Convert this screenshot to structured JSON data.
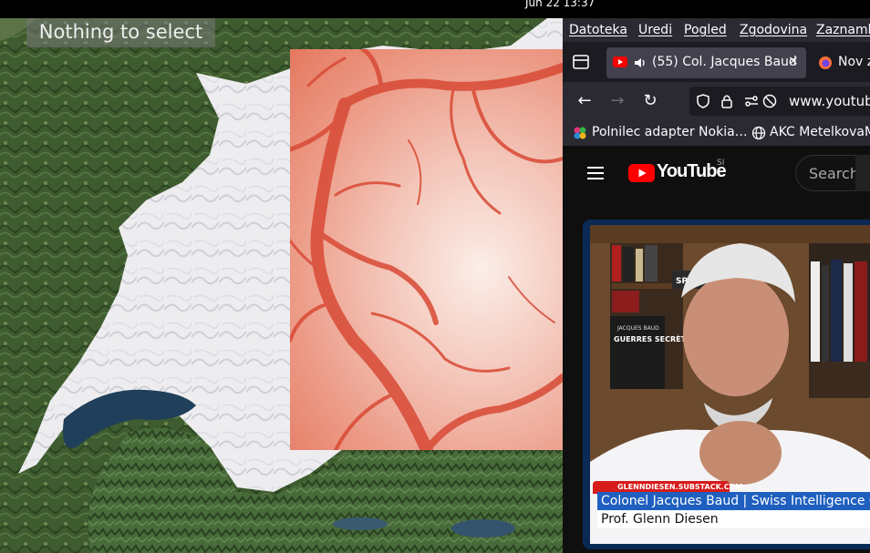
{
  "system": {
    "clock": "Jun 22  13:37"
  },
  "map_app": {
    "tooltip": "Nothing to select"
  },
  "browser": {
    "menu": [
      "Datoteka",
      "Uredi",
      "Pogled",
      "Zgodovina",
      "Zaznamki"
    ],
    "tabs": [
      {
        "title": "(55) Col. Jacques Baud",
        "close": "×"
      },
      {
        "title": "Nov z"
      }
    ],
    "url": "www.youtube",
    "bookmarks": [
      "Polnilec adapter Nokia…",
      "AKC MetelkovaM"
    ]
  },
  "youtube": {
    "logo_text": "YouTube",
    "region": "SI",
    "search_placeholder": "Search",
    "video": {
      "site_tag": "GLENNDIESEN.SUBSTACK.COM",
      "title_line": "Colonel Jacques Baud | Swiss Intelligence O",
      "host_line": "Prof. Glenn Diesen",
      "book_title": "GUERRES SECRÈTES EN UKRAINE",
      "book_author": "JACQUES BAUD",
      "book_spine": "SPY DUST"
    }
  }
}
